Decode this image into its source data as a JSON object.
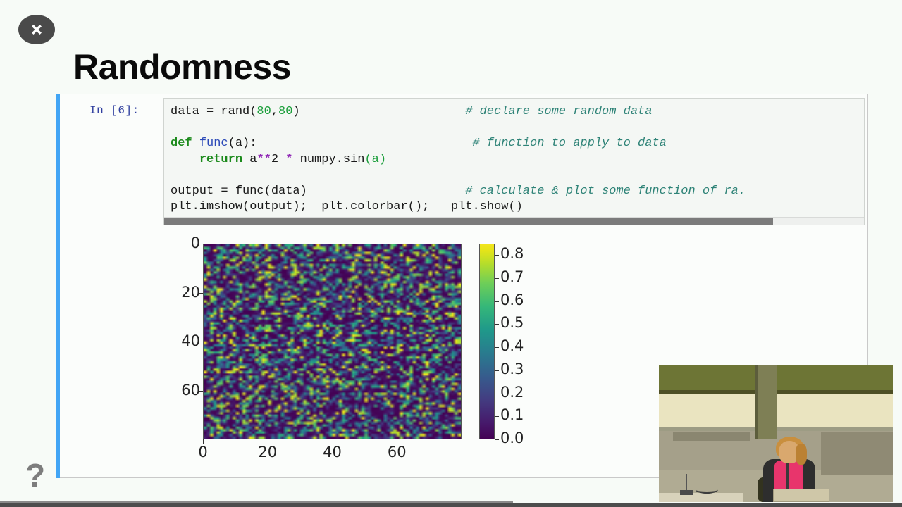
{
  "window": {
    "background_color": "#f7fbf7",
    "close_icon": "close-x-icon",
    "help_icon": "?"
  },
  "slide": {
    "title": "Randomness"
  },
  "notebook": {
    "cell_selected_color": "#42a5f5",
    "prompt": "In [6]:",
    "code_lines": [
      {
        "segments": [
          {
            "text": "data = rand(",
            "cls": "plain"
          },
          {
            "text": "80",
            "cls": "num"
          },
          {
            "text": ",",
            "cls": "plain"
          },
          {
            "text": "80",
            "cls": "num"
          },
          {
            "text": ")",
            "cls": "plain"
          }
        ],
        "comment": "# declare some random data",
        "comment_col": 41
      },
      {
        "segments": [],
        "comment": "",
        "comment_col": 0
      },
      {
        "segments": [
          {
            "text": "def ",
            "cls": "kw"
          },
          {
            "text": "func",
            "cls": "fn"
          },
          {
            "text": "(a):",
            "cls": "plain"
          }
        ],
        "comment": "# function to apply to data",
        "comment_col": 42
      },
      {
        "segments": [
          {
            "text": "    ",
            "cls": "plain"
          },
          {
            "text": "return",
            "cls": "kw"
          },
          {
            "text": " a",
            "cls": "plain"
          },
          {
            "text": "**",
            "cls": "op"
          },
          {
            "text": "2 ",
            "cls": "plain"
          },
          {
            "text": "*",
            "cls": "op"
          },
          {
            "text": " numpy.sin",
            "cls": "plain"
          },
          {
            "text": "(a)",
            "cls": "gr"
          }
        ],
        "comment": "",
        "comment_col": 0
      },
      {
        "segments": [],
        "comment": "",
        "comment_col": 0
      },
      {
        "segments": [
          {
            "text": "output = func(data)",
            "cls": "plain"
          }
        ],
        "comment": "# calculate & plot some function of ra.",
        "comment_col": 41
      },
      {
        "segments": [
          {
            "text": "plt.imshow(output);  plt.colorbar();   plt.show()",
            "cls": "plain"
          }
        ],
        "comment": "",
        "comment_col": 0
      }
    ],
    "code_raw": "data = rand(80,80)                       # declare some random data\n\ndef func(a):                              # function to apply to data\n    return a**2 * numpy.sin(a)\n\noutput = func(data)                      # calculate & plot some function of ra.\nplt.imshow(output);  plt.colorbar();   plt.show()",
    "scrollbar": {
      "orientation": "horizontal",
      "thumb_fraction_percent": 87
    }
  },
  "chart_data": {
    "type": "heatmap",
    "title": "",
    "xlabel": "",
    "ylabel": "",
    "colormap": "viridis",
    "grid": false,
    "legend_position": "right",
    "x_ticks": [
      "0",
      "20",
      "40",
      "60"
    ],
    "x_tick_values": [
      0,
      20,
      40,
      60
    ],
    "y_ticks": [
      "0",
      "20",
      "40",
      "60"
    ],
    "y_tick_values": [
      0,
      20,
      40,
      60
    ],
    "xlim": [
      0,
      80
    ],
    "ylim": [
      80,
      0
    ],
    "matrix_shape": [
      80,
      80
    ],
    "value_range": [
      0.0,
      0.85
    ],
    "colorbar": {
      "ticks": [
        "0.8",
        "0.7",
        "0.6",
        "0.5",
        "0.4",
        "0.3",
        "0.2",
        "0.1",
        "0.0"
      ],
      "tick_values": [
        0.8,
        0.7,
        0.6,
        0.5,
        0.4,
        0.3,
        0.2,
        0.1,
        0.0
      ],
      "min": 0.0,
      "max": 0.8,
      "stops": [
        "#440154",
        "#46196b",
        "#433c81",
        "#365c8d",
        "#297b8e",
        "#1f998a",
        "#35b779",
        "#6ece58",
        "#b5dd2b",
        "#e5e419",
        "#f2e51d"
      ]
    }
  },
  "webcam": {
    "label": "presenter-video-overlay"
  }
}
